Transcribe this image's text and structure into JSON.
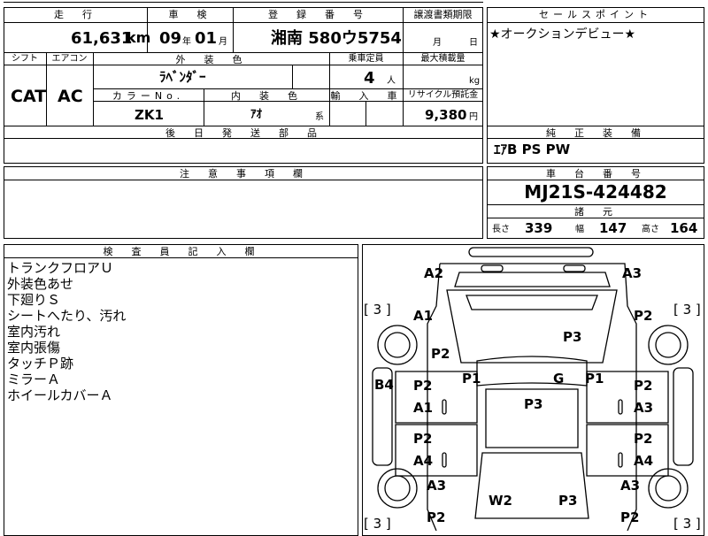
{
  "header": {
    "mileage_label": "走　行",
    "inspection_label": "車　検",
    "registration_label": "登　録　番　号",
    "transfer_date_label": "譲渡書類期限",
    "sales_point_label": "セールスポイント"
  },
  "mileage": {
    "value": "61,631",
    "unit": "km"
  },
  "inspection": {
    "year": "09",
    "year_unit": "年",
    "month": "01",
    "month_unit": "月"
  },
  "registration": {
    "plate": "湘南 580ウ5754"
  },
  "transfer_date": {
    "month_unit": "月",
    "day_unit": "日"
  },
  "sales_point": {
    "text": "★オークションデビュー★"
  },
  "row2": {
    "shift_label": "シフト",
    "shift_value": "CAT",
    "ac_label": "エアコン",
    "ac_value": "AC",
    "exterior_color_label": "外　装　色",
    "exterior_color_value": "ﾗﾍﾞﾝﾀﾞｰ",
    "capacity_label": "乗車定員",
    "capacity_value": "4",
    "capacity_unit": "人",
    "max_load_label": "最大積載量",
    "max_load_unit": "kg",
    "color_no_label": "カラーNo.",
    "color_no_value": "ZK1",
    "interior_color_label": "内　装　色",
    "interior_color_value": "ｱｵ",
    "interior_suffix": "系",
    "import_label": "輸　入　車",
    "recycle_label": "リサイクル預託金",
    "recycle_value": "9,380",
    "recycle_unit": "円"
  },
  "later_parts_label": "後　日　発　送　部　品",
  "genuine_equipment": {
    "label": "純　正　装　備",
    "value": "ｴｱB PS PW"
  },
  "caution": {
    "label": "注　意　事　項　欄"
  },
  "chassis": {
    "label": "車　台　番　号",
    "value": "MJ21S-424482"
  },
  "specs": {
    "label": "諸　元",
    "length_label": "長さ",
    "length_value": "339",
    "width_label": "幅",
    "width_value": "147",
    "height_label": "高さ",
    "height_value": "164"
  },
  "inspector": {
    "label": "検　査　員　記　入　欄",
    "notes": [
      "トランクフロアＵ",
      "外装色あせ",
      "下廻りＳ",
      "シートへたり、汚れ",
      "室内汚れ",
      "室内張傷",
      "タッチＰ跡",
      "ミラーＡ",
      "ホイールカバーＡ"
    ]
  },
  "diagram": {
    "marks": [
      "A2",
      "A3",
      "[ 3 ]",
      "A1",
      "P2",
      "[ 3 ]",
      "P3",
      "P2",
      "B4",
      "P2",
      "P1",
      "G",
      "P1",
      "P2",
      "A1",
      "P3",
      "A3",
      "P2",
      "P2",
      "A4",
      "A4",
      "A3",
      "A3",
      "W2",
      "P3",
      "P2",
      "P2",
      "[ 3 ]",
      "[ 3 ]"
    ]
  }
}
